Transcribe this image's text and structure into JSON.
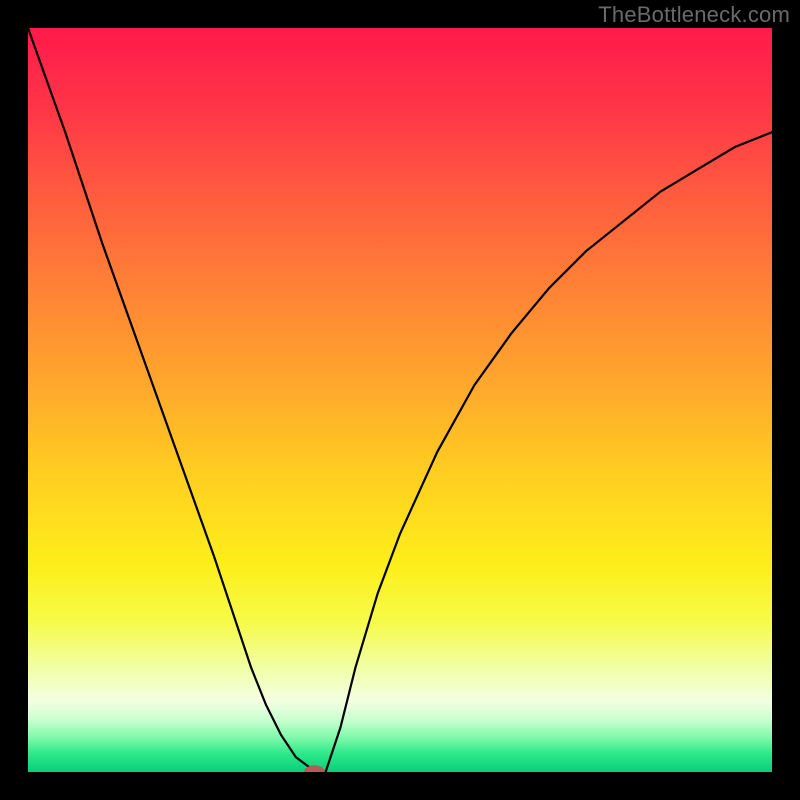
{
  "watermark": "TheBottleneck.com",
  "chart_data": {
    "type": "line",
    "title": "",
    "xlabel": "",
    "ylabel": "",
    "xlim": [
      0,
      100
    ],
    "ylim": [
      0,
      100
    ],
    "series": [
      {
        "name": "bottleneck-curve",
        "x": [
          0,
          5,
          10,
          15,
          20,
          25,
          28,
          30,
          32,
          34,
          36,
          38,
          40,
          42,
          44,
          47,
          50,
          55,
          60,
          65,
          70,
          75,
          80,
          85,
          90,
          95,
          100
        ],
        "y": [
          100,
          86,
          71,
          57,
          43,
          29,
          20,
          14,
          9,
          5,
          2,
          0.5,
          0,
          6,
          14,
          24,
          32,
          43,
          52,
          59,
          65,
          70,
          74,
          78,
          81,
          84,
          86
        ]
      }
    ],
    "marker": {
      "x": 38.5,
      "y": 0,
      "rx": 1.4,
      "ry": 0.9,
      "color": "#b55a56"
    },
    "gradient_stops": [
      {
        "offset": 0.0,
        "color": "#ff1a4b"
      },
      {
        "offset": 0.1,
        "color": "#ff3347"
      },
      {
        "offset": 0.22,
        "color": "#ff5a3f"
      },
      {
        "offset": 0.35,
        "color": "#ff8236"
      },
      {
        "offset": 0.48,
        "color": "#ffa82c"
      },
      {
        "offset": 0.6,
        "color": "#ffce20"
      },
      {
        "offset": 0.72,
        "color": "#fdee1a"
      },
      {
        "offset": 0.8,
        "color": "#f6fb4a"
      },
      {
        "offset": 0.86,
        "color": "#f1ffa6"
      },
      {
        "offset": 0.905,
        "color": "#f3ffe2"
      },
      {
        "offset": 0.93,
        "color": "#c9ffd0"
      },
      {
        "offset": 0.955,
        "color": "#7cf8a8"
      },
      {
        "offset": 0.975,
        "color": "#2ee98a"
      },
      {
        "offset": 1.0,
        "color": "#08cf78"
      }
    ]
  }
}
